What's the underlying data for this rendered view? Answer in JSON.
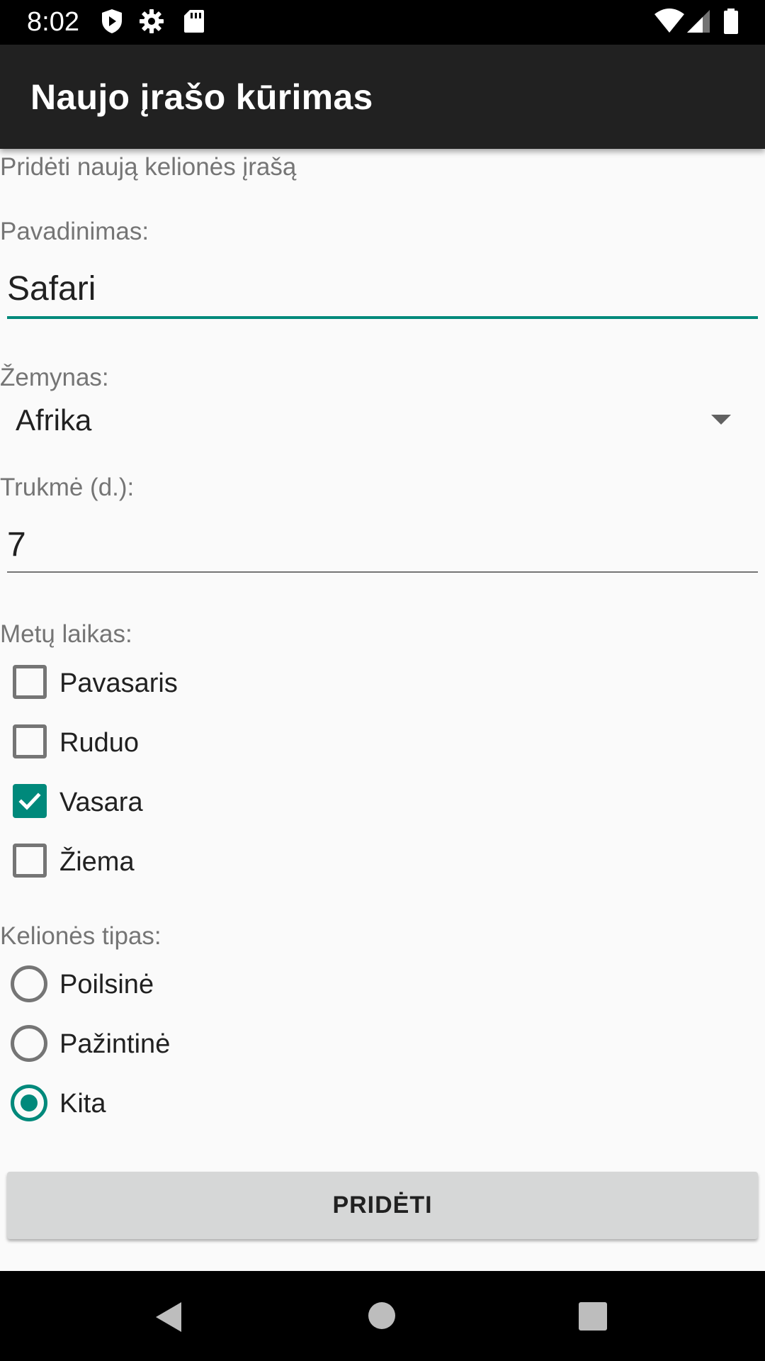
{
  "status_bar": {
    "time": "8:02",
    "left_icons": [
      "play-protect-icon",
      "settings-icon",
      "sd-card-icon"
    ],
    "right_icons": [
      "wifi-icon",
      "signal-icon",
      "battery-icon"
    ]
  },
  "app_bar": {
    "title": "Naujo įrašo kūrimas"
  },
  "form": {
    "heading": "Pridėti naują kelionės įrašą",
    "name": {
      "label": "Pavadinimas:",
      "value": "Safari"
    },
    "continent": {
      "label": "Žemynas:",
      "selected": "Afrika"
    },
    "duration": {
      "label": "Trukmė (d.):",
      "value": "7"
    },
    "season": {
      "label": "Metų laikas:",
      "options": [
        {
          "label": "Pavasaris",
          "checked": false
        },
        {
          "label": "Ruduo",
          "checked": false
        },
        {
          "label": "Vasara",
          "checked": true
        },
        {
          "label": "Žiema",
          "checked": false
        }
      ]
    },
    "trip_type": {
      "label": "Kelionės tipas:",
      "options": [
        {
          "label": "Poilsinė",
          "selected": false
        },
        {
          "label": "Pažintinė",
          "selected": false
        },
        {
          "label": "Kita",
          "selected": true
        }
      ]
    },
    "submit_label": "PRIDĖTI"
  },
  "colors": {
    "accent": "#00897b",
    "app_bar": "#212121",
    "background": "#fafafa",
    "button": "#d6d7d7"
  },
  "nav_bar": {
    "icons": [
      "back-icon",
      "home-icon",
      "recents-icon"
    ]
  }
}
